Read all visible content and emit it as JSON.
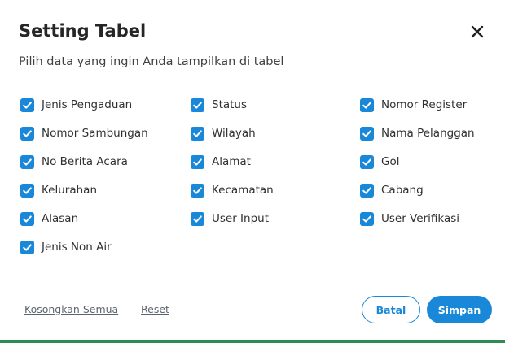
{
  "dialog": {
    "title": "Setting Tabel",
    "subtitle": "Pilih data yang ingin Anda tampilkan di tabel",
    "close_icon": "close-icon"
  },
  "options": {
    "col1": [
      {
        "label": "Jenis Pengaduan",
        "checked": true
      },
      {
        "label": "Nomor Sambungan",
        "checked": true
      },
      {
        "label": "No Berita Acara",
        "checked": true
      },
      {
        "label": "Kelurahan",
        "checked": true
      },
      {
        "label": "Alasan",
        "checked": true
      },
      {
        "label": "Jenis Non Air",
        "checked": true
      }
    ],
    "col2": [
      {
        "label": "Status",
        "checked": true
      },
      {
        "label": "Wilayah",
        "checked": true
      },
      {
        "label": "Alamat",
        "checked": true
      },
      {
        "label": "Kecamatan",
        "checked": true
      },
      {
        "label": "User Input",
        "checked": true
      }
    ],
    "col3": [
      {
        "label": "Nomor Register",
        "checked": true
      },
      {
        "label": "Nama Pelanggan",
        "checked": true
      },
      {
        "label": "Gol",
        "checked": true
      },
      {
        "label": "Cabang",
        "checked": true
      },
      {
        "label": "User Verifikasi",
        "checked": true
      }
    ]
  },
  "footer": {
    "clear_all": "Kosongkan Semua",
    "reset": "Reset",
    "cancel": "Batal",
    "save": "Simpan"
  },
  "colors": {
    "accent": "#1a88d8",
    "bottom_border": "#2e8b57"
  }
}
